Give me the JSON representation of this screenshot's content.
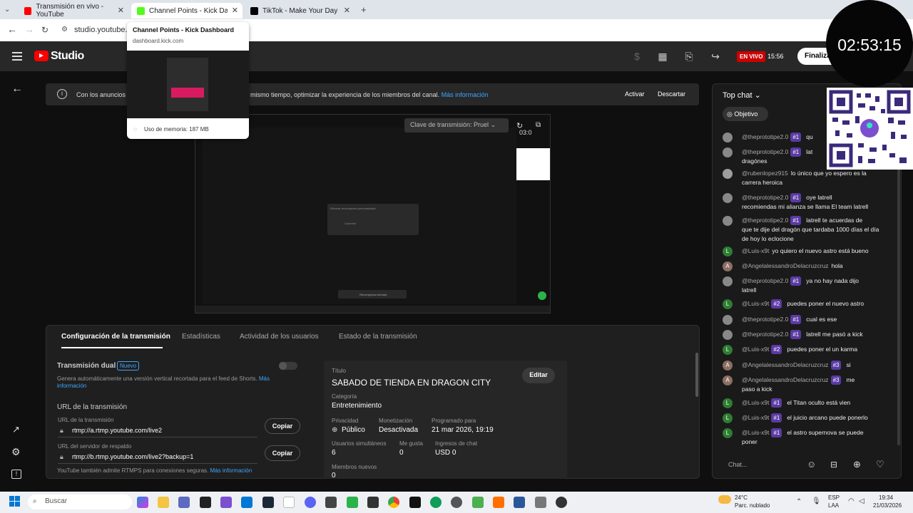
{
  "browser": {
    "tabs": [
      {
        "title": "Transmisión en vivo - YouTube",
        "color": "#ff0000"
      },
      {
        "title": "Channel Points - Kick Dashboard",
        "color": "#53fc18"
      },
      {
        "title": "TikTok - Make Your Day",
        "color": "#000000"
      }
    ],
    "url": "studio.youtube.co",
    "tooltip": {
      "title": "Channel Points - Kick Dashboard",
      "domain": "dashboard.kick.com",
      "memory": "Uso de memoria: 187 MB"
    }
  },
  "studio": {
    "logo_text": "Studio",
    "live_badge": "EN VIVO",
    "live_time": "15:56",
    "finalize": "Finaliza"
  },
  "notice": {
    "text_a": "Con los anuncios a",
    "text_b": "mismo tiempo, optimizar la experiencia de los miembros del canal.",
    "link": "Más información",
    "activate": "Activar",
    "dismiss": "Descartar"
  },
  "preview": {
    "stream_key_label": "Clave de transmisión: Pruel",
    "timer": "03:0",
    "dialog_title": "Eliminar recompensa personalizada",
    "dialog_cancel": "Cancelar",
    "toast": "Recompensa borrada"
  },
  "panel": {
    "tabs": [
      "Configuración de la transmisión",
      "Estadísticas",
      "Actividad de los usuarios",
      "Estado de la transmisión"
    ],
    "dual_title": "Transmisión dual",
    "dual_badge": "Nuevo",
    "dual_desc": "Genera automáticamente una versión vertical recortada para el feed de Shorts.",
    "dual_link_a": "Más",
    "dual_link_b": "información",
    "url_section": "URL de la transmisión",
    "url_label": "URL de la transmisión",
    "url_value": "rtmp://a.rtmp.youtube.com/live2",
    "backup_label": "URL del servidor de respaldo",
    "backup_value": "rtmp://b.rtmp.youtube.com/live2?backup=1",
    "copy": "Copiar",
    "rtmps_note": "YouTube también admite RTMPS para conexiones seguras.",
    "rtmps_link": "Más información"
  },
  "details": {
    "title_label": "Título",
    "title_value": "SABADO DE TIENDA EN DRAGON CITY",
    "edit": "Editar",
    "category_label": "Categoría",
    "category_value": "Entretenimiento",
    "privacy_label": "Privacidad",
    "privacy_value": "Público",
    "monet_label": "Monetización",
    "monet_value": "Desactivada",
    "sched_label": "Programado para",
    "sched_value": "21 mar 2026, 19:19",
    "concurrent_label": "Usuarios simultáneos",
    "concurrent_value": "6",
    "likes_label": "Me gusta",
    "likes_value": "0",
    "chat_income_label": "Ingresos de chat",
    "chat_income_value": "USD 0",
    "new_members_label": "Miembros nuevos",
    "new_members_value": "0"
  },
  "chat": {
    "header": "Top chat",
    "objective": "Objetivo",
    "input_placeholder": "Chat...",
    "clock": "02:53:15",
    "messages": [
      {
        "name": "@theprototipe2.0",
        "badge": "#1",
        "text": "qu",
        "text2": "",
        "avatar": "#888",
        "initial": ""
      },
      {
        "name": "@theprototipe2.0",
        "badge": "#1",
        "text": "lat",
        "text2": "dragónes",
        "avatar": "#888",
        "initial": ""
      },
      {
        "name": "@rubenlopez915",
        "badge": "",
        "text": "lo único que yo espero es la",
        "text2": "carrera heroica",
        "avatar": "#9e9e9e",
        "initial": ""
      },
      {
        "name": "@theprototipe2.0",
        "badge": "#1",
        "text": "oye latrell",
        "text2": "recomiendas mi alianza se llama El team latrell",
        "avatar": "#888",
        "initial": ""
      },
      {
        "name": "@theprototipe2.0",
        "badge": "#1",
        "text": "latrell te acuerdas de",
        "text2": "que te dije del dragón que tardaba 1000 días el día",
        "text3": "de hoy lo eclocione",
        "avatar": "#888",
        "initial": ""
      },
      {
        "name": "@Luis-x9t",
        "badge": "",
        "text": "yo quiero el nuevo astro está bueno",
        "text2": "",
        "avatar": "#2e7d32",
        "initial": "L"
      },
      {
        "name": "@AngelalessandroDelacruzcruz",
        "badge": "",
        "text": "hola",
        "text2": "",
        "avatar": "#8d6e63",
        "initial": "A"
      },
      {
        "name": "@theprototipe2.0",
        "badge": "#1",
        "text": "ya no hay nada dijo",
        "text2": "latrell",
        "avatar": "#888",
        "initial": ""
      },
      {
        "name": "@Luis-x9t",
        "badge": "#2",
        "text": "puedes poner el nuevo astro",
        "text2": "",
        "avatar": "#2e7d32",
        "initial": "L"
      },
      {
        "name": "@theprototipe2.0",
        "badge": "#1",
        "text": "cual es ese",
        "text2": "",
        "avatar": "#888",
        "initial": ""
      },
      {
        "name": "@theprototipe2.0",
        "badge": "#1",
        "text": "latrell me pasó a kick",
        "text2": "",
        "avatar": "#888",
        "initial": ""
      },
      {
        "name": "@Luis-x9t",
        "badge": "#2",
        "text": "puedes poner el un karma",
        "text2": "",
        "avatar": "#2e7d32",
        "initial": "L"
      },
      {
        "name": "@AngelalessandroDelacruzcruz",
        "badge": "#3",
        "text": "si",
        "text2": "",
        "avatar": "#8d6e63",
        "initial": "A"
      },
      {
        "name": "@AngelalessandroDelacruzcruz",
        "badge": "#3",
        "text": "me",
        "text2": "paso a kick",
        "avatar": "#8d6e63",
        "initial": "A"
      },
      {
        "name": "@Luis-x9t",
        "badge": "#1",
        "text": "el Titan oculto está vien",
        "text2": "",
        "avatar": "#2e7d32",
        "initial": "L"
      },
      {
        "name": "@Luis-x9t",
        "badge": "#1",
        "text": "el juicio arcano puede ponerlo",
        "text2": "",
        "avatar": "#2e7d32",
        "initial": "L"
      },
      {
        "name": "@Luis-x9t",
        "badge": "#1",
        "text": "el astro supernova se puede",
        "text2": "poner",
        "avatar": "#2e7d32",
        "initial": "L"
      }
    ]
  },
  "taskbar": {
    "search": "Buscar",
    "weather_temp": "24°C",
    "weather_desc": "Parc. nublado",
    "lang": "ESP",
    "lang2": "LAA",
    "time": "19:34",
    "date": "21/03/2026"
  }
}
